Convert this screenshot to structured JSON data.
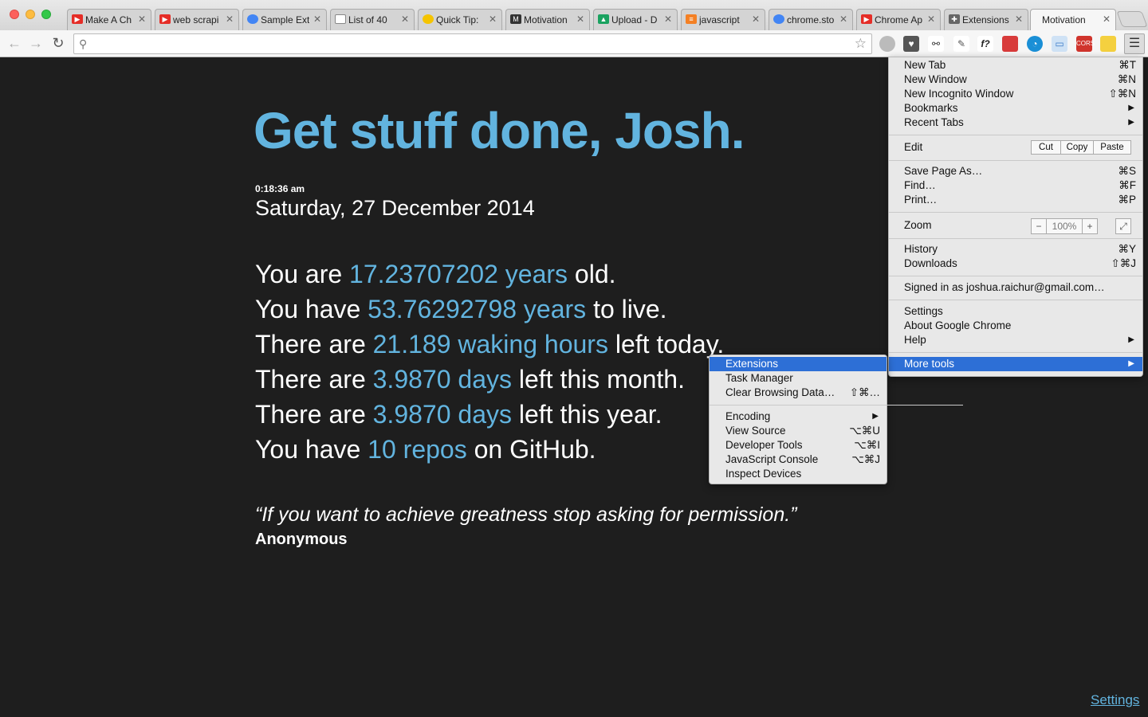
{
  "browser": {
    "tabs": [
      {
        "label": "Make A Ch",
        "icon": "youtube-icon",
        "color": "#e52d27"
      },
      {
        "label": "web scrapi",
        "icon": "youtube-icon",
        "color": "#e52d27"
      },
      {
        "label": "Sample Ext",
        "icon": "chrome-icon",
        "color": "#4285f4"
      },
      {
        "label": "List of 40",
        "icon": "document-icon",
        "color": "#ffffff"
      },
      {
        "label": "Quick Tip:",
        "icon": "lightbulb-icon",
        "color": "#f5c400"
      },
      {
        "label": "Motivation",
        "icon": "medium-icon",
        "color": "#333333"
      },
      {
        "label": "Upload - D",
        "icon": "drive-icon",
        "color": "#1aa260"
      },
      {
        "label": "javascript",
        "icon": "stackoverflow-icon",
        "color": "#f48024"
      },
      {
        "label": "chrome.sto",
        "icon": "chrome-icon",
        "color": "#4285f4"
      },
      {
        "label": "Chrome Ap",
        "icon": "youtube-icon",
        "color": "#e52d27"
      },
      {
        "label": "Extensions",
        "icon": "puzzle-icon",
        "color": "#666666"
      },
      {
        "label": "Motivation",
        "icon": "",
        "color": "#f6f6f6"
      }
    ],
    "omnibox_value": ""
  },
  "page": {
    "headline": "Get stuff done, Josh.",
    "time": "0:18:36 am",
    "date": "Saturday, 27 December 2014",
    "stats": [
      {
        "pre": "You are ",
        "value": "17.23707202 years",
        "post": " old."
      },
      {
        "pre": "You have ",
        "value": "53.76292798 years",
        "post": " to live."
      },
      {
        "pre": "There are ",
        "value": "21.189 waking hours",
        "post": " left today."
      },
      {
        "pre": "There are ",
        "value": "3.9870 days",
        "post": " left this month."
      },
      {
        "pre": "There are ",
        "value": "3.9870 days",
        "post": " left this year."
      },
      {
        "pre": "You have ",
        "value": "10 repos",
        "post": " on GitHub."
      }
    ],
    "quote": "“If you want to achieve greatness stop asking for permission.”",
    "author": "Anonymous",
    "settings_link": "Settings",
    "accent_color": "#62b4df"
  },
  "chrome_menu": {
    "new_tab": {
      "label": "New Tab",
      "shortcut": "⌘T"
    },
    "new_window": {
      "label": "New Window",
      "shortcut": "⌘N"
    },
    "new_incognito": {
      "label": "New Incognito Window",
      "shortcut": "⇧⌘N"
    },
    "bookmarks": {
      "label": "Bookmarks"
    },
    "recent_tabs": {
      "label": "Recent Tabs"
    },
    "edit": {
      "label": "Edit",
      "cut": "Cut",
      "copy": "Copy",
      "paste": "Paste"
    },
    "save_page": {
      "label": "Save Page As…",
      "shortcut": "⌘S"
    },
    "find": {
      "label": "Find…",
      "shortcut": "⌘F"
    },
    "print": {
      "label": "Print…",
      "shortcut": "⌘P"
    },
    "zoom": {
      "label": "Zoom",
      "minus": "−",
      "value": "100%",
      "plus": "+"
    },
    "history": {
      "label": "History",
      "shortcut": "⌘Y"
    },
    "downloads": {
      "label": "Downloads",
      "shortcut": "⇧⌘J"
    },
    "signed_in": "Signed in as joshua.raichur@gmail.com…",
    "settings": "Settings",
    "about": "About Google Chrome",
    "help": "Help",
    "more_tools": "More tools"
  },
  "more_tools_menu": {
    "extensions": {
      "label": "Extensions",
      "shortcut": ""
    },
    "task_manager": {
      "label": "Task Manager",
      "shortcut": ""
    },
    "clear_data": {
      "label": "Clear Browsing Data…",
      "shortcut": "⇧⌘…"
    },
    "encoding": {
      "label": "Encoding"
    },
    "view_source": {
      "label": "View Source",
      "shortcut": "⌥⌘U"
    },
    "dev_tools": {
      "label": "Developer Tools",
      "shortcut": "⌥⌘I"
    },
    "js_console": {
      "label": "JavaScript Console",
      "shortcut": "⌥⌘J"
    },
    "inspect_devices": {
      "label": "Inspect Devices",
      "shortcut": ""
    }
  }
}
